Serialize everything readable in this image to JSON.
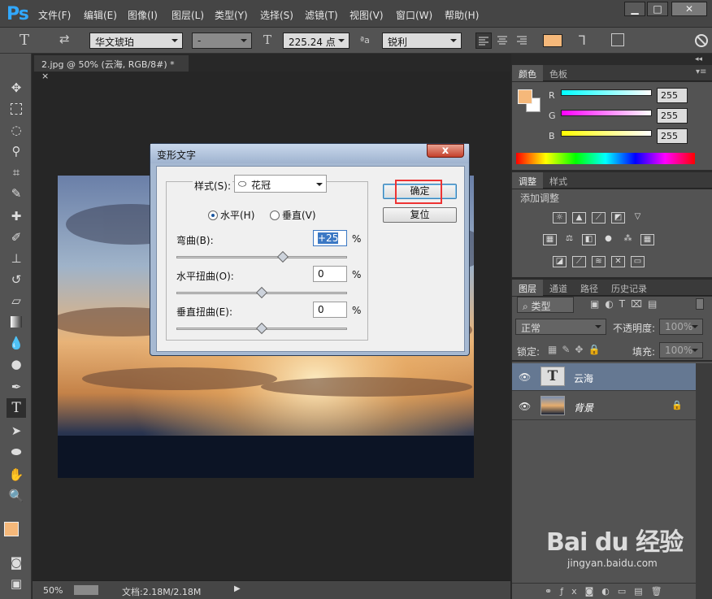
{
  "app": {
    "logo": "Ps",
    "menus": [
      "文件(F)",
      "编辑(E)",
      "图像(I)",
      "图层(L)",
      "类型(Y)",
      "选择(S)",
      "滤镜(T)",
      "视图(V)",
      "窗口(W)",
      "帮助(H)"
    ]
  },
  "window_buttons": {
    "minimize": "▁",
    "maximize": "□",
    "close": "✕"
  },
  "options": {
    "tool_glyph": "T",
    "font_family": "华文琥珀",
    "font_style": "-",
    "font_size": "225.24 点",
    "aa_label": "ªa",
    "aa_mode": "锐利",
    "fg_color": "#f5b87a"
  },
  "document": {
    "tab_title": "2.jpg @ 50% (云海, RGB/8#) *",
    "tab_close": "×"
  },
  "status": {
    "zoom": "50%",
    "doc_info": "文档:2.18M/2.18M"
  },
  "dialog": {
    "title": "变形文字",
    "close": "x",
    "style_label": "样式(S):",
    "style_icon": "⬭",
    "style_value": "花冠",
    "orientation": {
      "horizontal": "水平(H)",
      "vertical": "垂直(V)",
      "selected": "horizontal"
    },
    "bend": {
      "label": "弯曲(B):",
      "value": "+25",
      "unit": "%",
      "level": 0.625
    },
    "h_distort": {
      "label": "水平扭曲(O):",
      "value": "0",
      "unit": "%",
      "level": 0.5
    },
    "v_distort": {
      "label": "垂直扭曲(E):",
      "value": "0",
      "unit": "%",
      "level": 0.5
    },
    "ok": "确定",
    "reset": "复位"
  },
  "color_panel": {
    "tabs": [
      "颜色",
      "色板"
    ],
    "channels": [
      {
        "name": "R",
        "value": "255"
      },
      {
        "name": "G",
        "value": "255"
      },
      {
        "name": "B",
        "value": "255"
      }
    ]
  },
  "adjust_panel": {
    "tabs": [
      "调整",
      "样式"
    ],
    "heading": "添加调整"
  },
  "layers_panel": {
    "tabs": [
      "图层",
      "通道",
      "路径",
      "历史记录"
    ],
    "filter": "类型",
    "blend_mode": "正常",
    "opacity_label": "不透明度:",
    "opacity": "100%",
    "lock_label": "锁定:",
    "fill_label": "填充:",
    "fill": "100%",
    "layers": [
      {
        "name": "云海",
        "kind": "text",
        "selected": true
      },
      {
        "name": "背景",
        "kind": "image",
        "locked": true
      }
    ]
  },
  "watermark": {
    "brand": "Bai du 经验",
    "url": "jingyan.baidu.com"
  }
}
